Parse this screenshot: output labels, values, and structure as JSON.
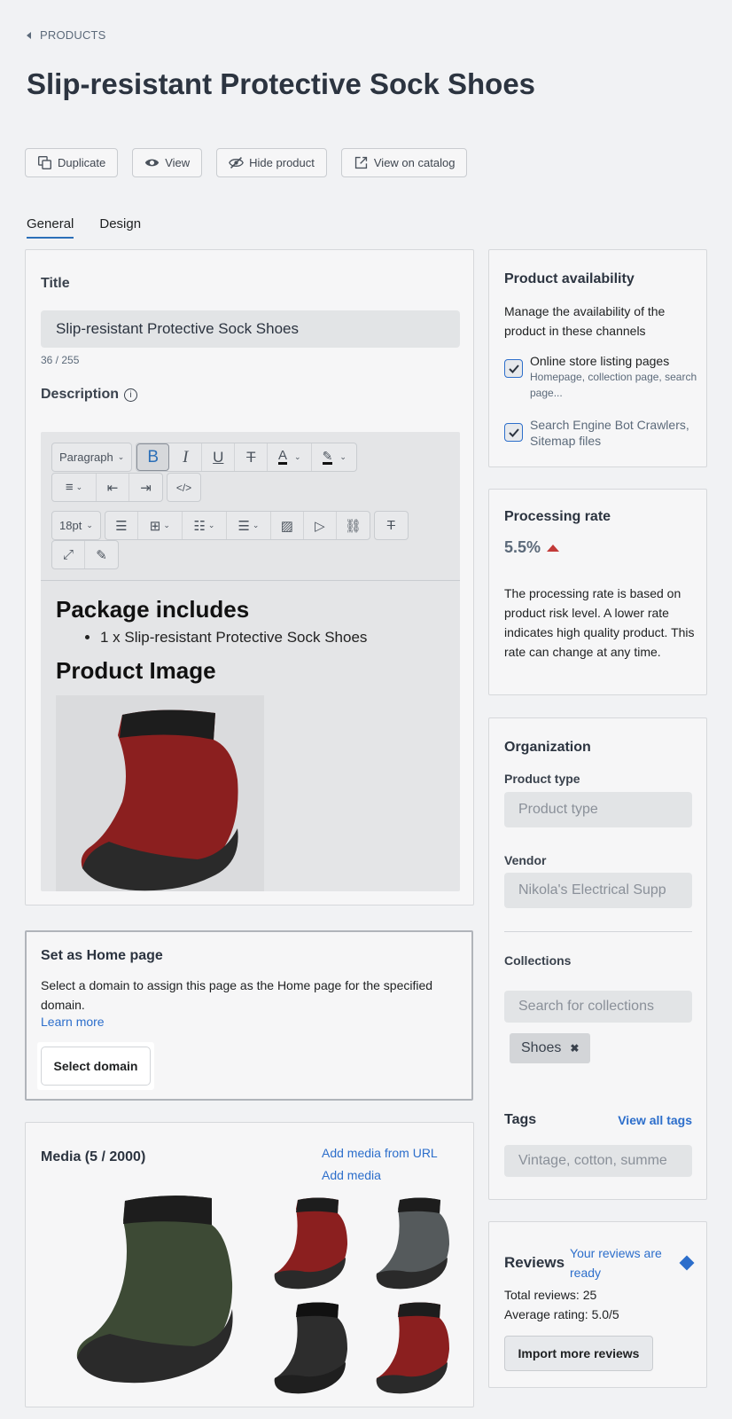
{
  "breadcrumb": {
    "label": "PRODUCTS"
  },
  "page": {
    "title": "Slip-resistant Protective Sock Shoes"
  },
  "actions": [
    {
      "label": "Duplicate",
      "icon": "duplicate-icon"
    },
    {
      "label": "View",
      "icon": "eye-icon"
    },
    {
      "label": "Hide product",
      "icon": "eye-off-icon"
    },
    {
      "label": "View on catalog",
      "icon": "external-link-icon"
    }
  ],
  "tabs": [
    {
      "label": "General",
      "active": true
    },
    {
      "label": "Design",
      "active": false
    }
  ],
  "general": {
    "title_label": "Title",
    "title_value": "Slip-resistant Protective Sock Shoes",
    "title_counter": "36 / 255",
    "description_label": "Description",
    "toolbar": {
      "paragraph": "Paragraph",
      "font_size": "18pt"
    },
    "editor": {
      "heading1": "Package includes",
      "list_item": "1 x Slip-resistant Protective Sock Shoes",
      "heading2": "Product Image"
    }
  },
  "home_page": {
    "title": "Set as Home page",
    "text": "Select a domain to assign this page as the Home page for the specified domain.",
    "learn_more": "Learn more",
    "select_domain": "Select domain"
  },
  "media": {
    "title": "Media (5 / 2000)",
    "add_from_url": "Add media from URL",
    "add_media": "Add media"
  },
  "availability": {
    "title": "Product availability",
    "description": "Manage the availability of the product in these channels",
    "channels": [
      {
        "label": "Online store listing pages",
        "sub": "Homepage, collection page, search page...",
        "checked": true
      },
      {
        "label": "Search Engine Bot Crawlers, Sitemap files",
        "sub": "",
        "checked": true
      }
    ]
  },
  "processing": {
    "title": "Processing rate",
    "value": "5.5%",
    "trend_color": "#c23a38",
    "text": "The processing rate is based on product risk level. A lower rate indicates high quality product. This rate can change at any time."
  },
  "organization": {
    "title": "Organization",
    "product_type_label": "Product type",
    "product_type_placeholder": "Product type",
    "vendor_label": "Vendor",
    "vendor_placeholder": "Nikola's Electrical Supp",
    "collections_label": "Collections",
    "collections_placeholder": "Search for collections",
    "collection_chip": "Shoes",
    "tags_label": "Tags",
    "view_all_tags": "View all tags",
    "tags_placeholder": "Vintage, cotton, summe"
  },
  "reviews": {
    "title": "Reviews",
    "ready": "Your reviews are ready",
    "total": "Total reviews: 25",
    "average": "Average rating: 5.0/5",
    "import": "Import more reviews"
  },
  "colors": {
    "accent": "#2c6ecb",
    "tab_underline": "#2b6fb8",
    "sock_red": "#8b1f1f",
    "sock_green": "#3d4a35"
  }
}
